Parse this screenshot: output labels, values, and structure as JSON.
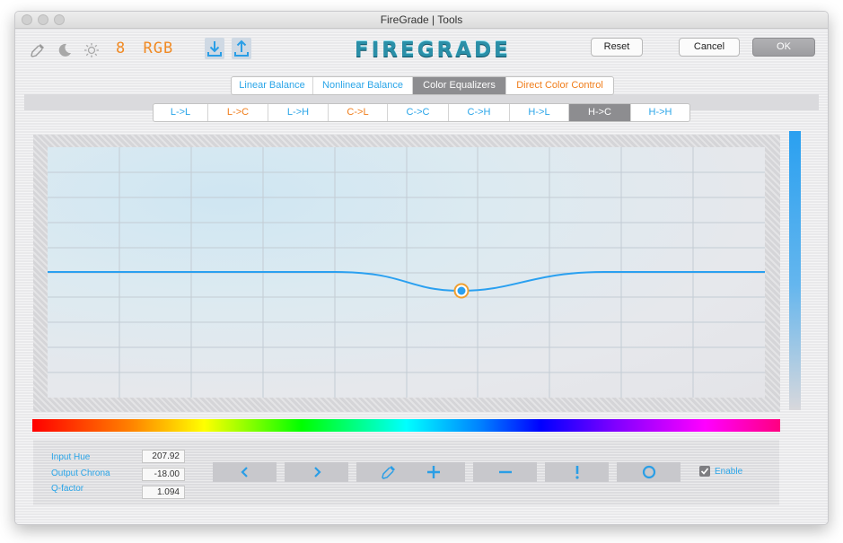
{
  "window": {
    "title": "FireGrade | Tools"
  },
  "toolbar": {
    "bits": "8",
    "color_space": "RGB",
    "logo": "FIREGRADE",
    "reset_label": "Reset",
    "cancel_label": "Cancel",
    "ok_label": "OK"
  },
  "mode_tabs": [
    {
      "label": "Linear Balance",
      "color": "#2aa5e8",
      "active": false
    },
    {
      "label": "Nonlinear Balance",
      "color": "#2aa5e8",
      "active": false
    },
    {
      "label": "Color Equalizers",
      "color": "#ffffff",
      "active": true
    },
    {
      "label": "Direct Color Control",
      "color": "#f07d1a",
      "active": false
    }
  ],
  "eq_tabs": [
    {
      "label": "L->L",
      "color": "#2aa5e8",
      "active": false
    },
    {
      "label": "L->C",
      "color": "#f07d1a",
      "active": false
    },
    {
      "label": "L->H",
      "color": "#2aa5e8",
      "active": false
    },
    {
      "label": "C->L",
      "color": "#f07d1a",
      "active": false
    },
    {
      "label": "C->C",
      "color": "#2aa5e8",
      "active": false
    },
    {
      "label": "C->H",
      "color": "#2aa5e8",
      "active": false
    },
    {
      "label": "H->L",
      "color": "#2aa5e8",
      "active": false
    },
    {
      "label": "H->C",
      "color": "#ffffff",
      "active": true
    },
    {
      "label": "H->H",
      "color": "#2aa5e8",
      "active": false
    }
  ],
  "params": {
    "input_hue_label": "Input Hue",
    "input_hue_value": "207.92",
    "output_chroma_label": "Output Chrona",
    "output_chroma_value": "-18.00",
    "q_factor_label": "Q-factor",
    "q_factor_value": "1.094"
  },
  "tools": [
    {
      "name": "prev-point-icon"
    },
    {
      "name": "next-point-icon"
    },
    {
      "name": "pick-color-icon"
    },
    {
      "name": "add-point-icon"
    },
    {
      "name": "remove-point-icon"
    },
    {
      "name": "warning-icon"
    },
    {
      "name": "reset-curve-icon"
    }
  ],
  "enable": {
    "label": "Enable",
    "checked": true
  },
  "curve": {
    "selected_hue": 207.92,
    "output_chroma": -18.0,
    "q_factor": 1.094
  },
  "colors": {
    "accent_blue": "#2aa5e8",
    "accent_orange": "#f07d1a",
    "control_point": "#2aa0f0",
    "control_point_ring": "#f0a030"
  }
}
